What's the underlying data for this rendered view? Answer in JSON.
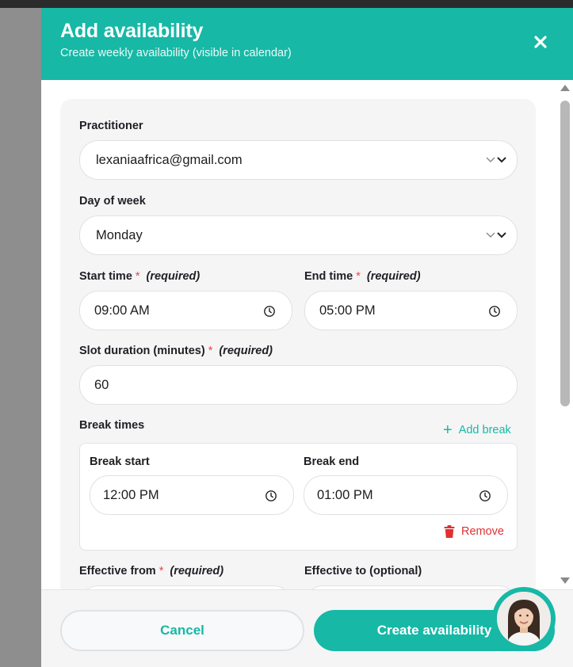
{
  "header": {
    "title": "Add availability",
    "subtitle": "Create weekly availability (visible in calendar)"
  },
  "form": {
    "practitioner": {
      "label": "Practitioner",
      "value": "lexaniaafrica@gmail.com"
    },
    "day_of_week": {
      "label": "Day of week",
      "value": "Monday"
    },
    "start_time": {
      "label": "Start time",
      "required_mark": "*",
      "required_text": "(required)",
      "value": "09:00 AM"
    },
    "end_time": {
      "label": "End time",
      "required_mark": "*",
      "required_text": "(required)",
      "value": "05:00 PM"
    },
    "slot_duration": {
      "label": "Slot duration (minutes)",
      "required_mark": "*",
      "required_text": "(required)",
      "value": "60"
    },
    "break_times": {
      "label": "Break times",
      "add_label": "Add break",
      "items": [
        {
          "start_label": "Break start",
          "start_value": "12:00 PM",
          "end_label": "Break end",
          "end_value": "01:00 PM",
          "remove_label": "Remove"
        }
      ]
    },
    "effective_from": {
      "label": "Effective from",
      "required_mark": "*",
      "required_text": "(required)"
    },
    "effective_to": {
      "label": "Effective to (optional)"
    }
  },
  "footer": {
    "cancel_label": "Cancel",
    "create_label": "Create availability"
  },
  "colors": {
    "accent": "#17b8a6",
    "danger": "#e03131",
    "required_star": "#e5484d"
  },
  "icons": {
    "close": "close-icon",
    "dropdown": "chevron-down-icon",
    "time": "clock-icon",
    "add": "plus-icon",
    "remove": "trash-icon",
    "assistant": "assistant-avatar"
  }
}
